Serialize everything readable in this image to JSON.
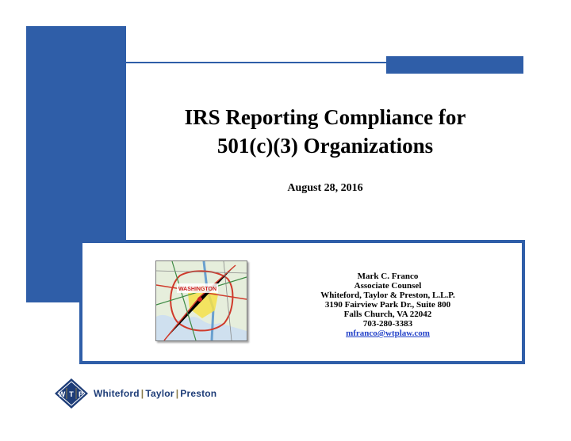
{
  "slide": {
    "title_line1": "IRS Reporting Compliance for",
    "title_line2": "501(c)(3) Organizations",
    "date": "August 28, 2016"
  },
  "contact": {
    "name": "Mark C. Franco",
    "position": "Associate Counsel",
    "firm": "Whiteford, Taylor & Preston, L.L.P.",
    "address1": "3190 Fairview Park Dr., Suite 800",
    "address2": "Falls Church, VA 22042",
    "phone": "703-280-3383",
    "email": "mfranco@wtplaw.com"
  },
  "map": {
    "center_label": "WASHINGTON"
  },
  "logo": {
    "monogram": [
      "W",
      "T",
      "P"
    ],
    "name_parts": [
      "Whiteford",
      "Taylor",
      "Preston"
    ],
    "separator": "|",
    "colors": {
      "primary": "#1e3d78",
      "accent": "#8b7b4a"
    }
  },
  "theme": {
    "accent_blue": "#2f5ea8",
    "link_blue": "#2140c8"
  }
}
